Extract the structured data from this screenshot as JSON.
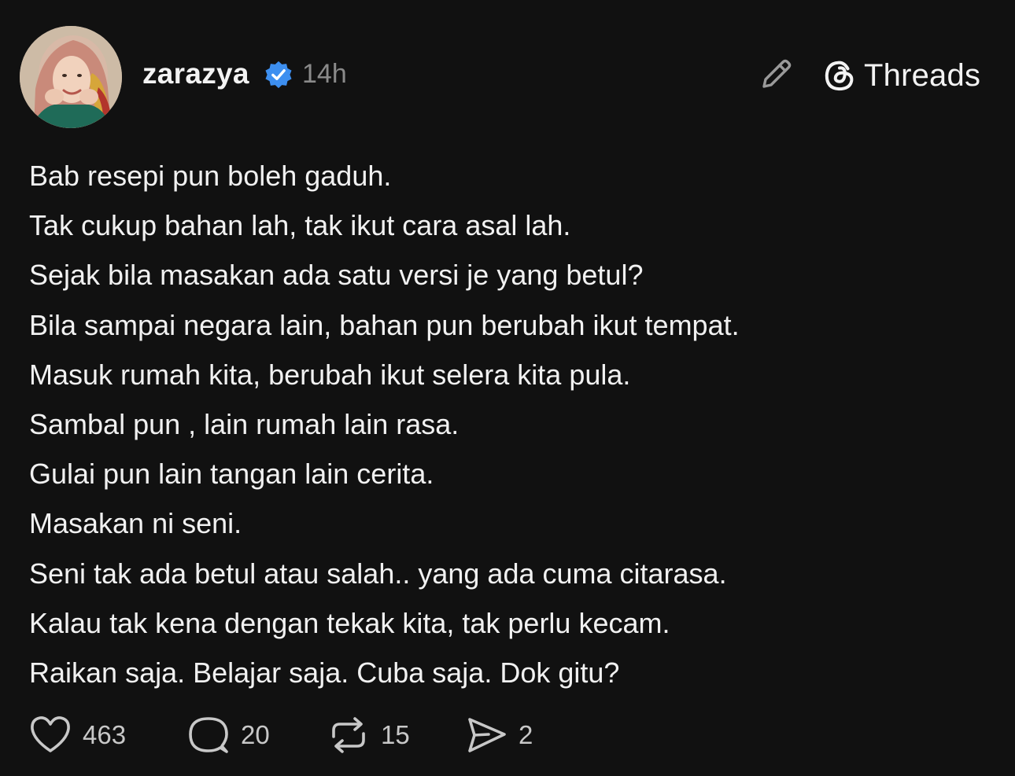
{
  "header": {
    "username": "zarazya",
    "time": "14h",
    "brand_label": "Threads",
    "icons": {
      "avatar": "profile-photo",
      "verified": "verified-badge-icon",
      "edit": "pencil-icon",
      "brand": "threads-logo-icon"
    },
    "colors": {
      "verified": "#3d8ff0",
      "muted": "#8a8a8a"
    }
  },
  "post": {
    "lines": [
      "Bab resepi pun boleh gaduh.",
      "Tak cukup bahan lah, tak ikut cara asal lah.",
      "Sejak bila masakan ada satu versi je yang betul?",
      "Bila sampai negara lain, bahan pun berubah ikut tempat.",
      "Masuk rumah kita, berubah ikut selera kita pula.",
      "Sambal pun , lain rumah lain rasa.",
      "Gulai pun lain tangan lain cerita.",
      "Masakan ni seni.",
      "Seni tak ada betul atau salah.. yang ada cuma citarasa.",
      "Kalau tak kena dengan tekak kita, tak perlu kecam.",
      "Raikan saja. Belajar saja. Cuba saja. Dok gitu?"
    ]
  },
  "actions": {
    "like": {
      "icon": "heart-icon",
      "count": "463"
    },
    "reply": {
      "icon": "comment-icon",
      "count": "20"
    },
    "repost": {
      "icon": "repost-icon",
      "count": "15"
    },
    "share": {
      "icon": "share-icon",
      "count": "2"
    }
  },
  "theme": {
    "background": "#111111",
    "text": "#f3f3f3"
  }
}
